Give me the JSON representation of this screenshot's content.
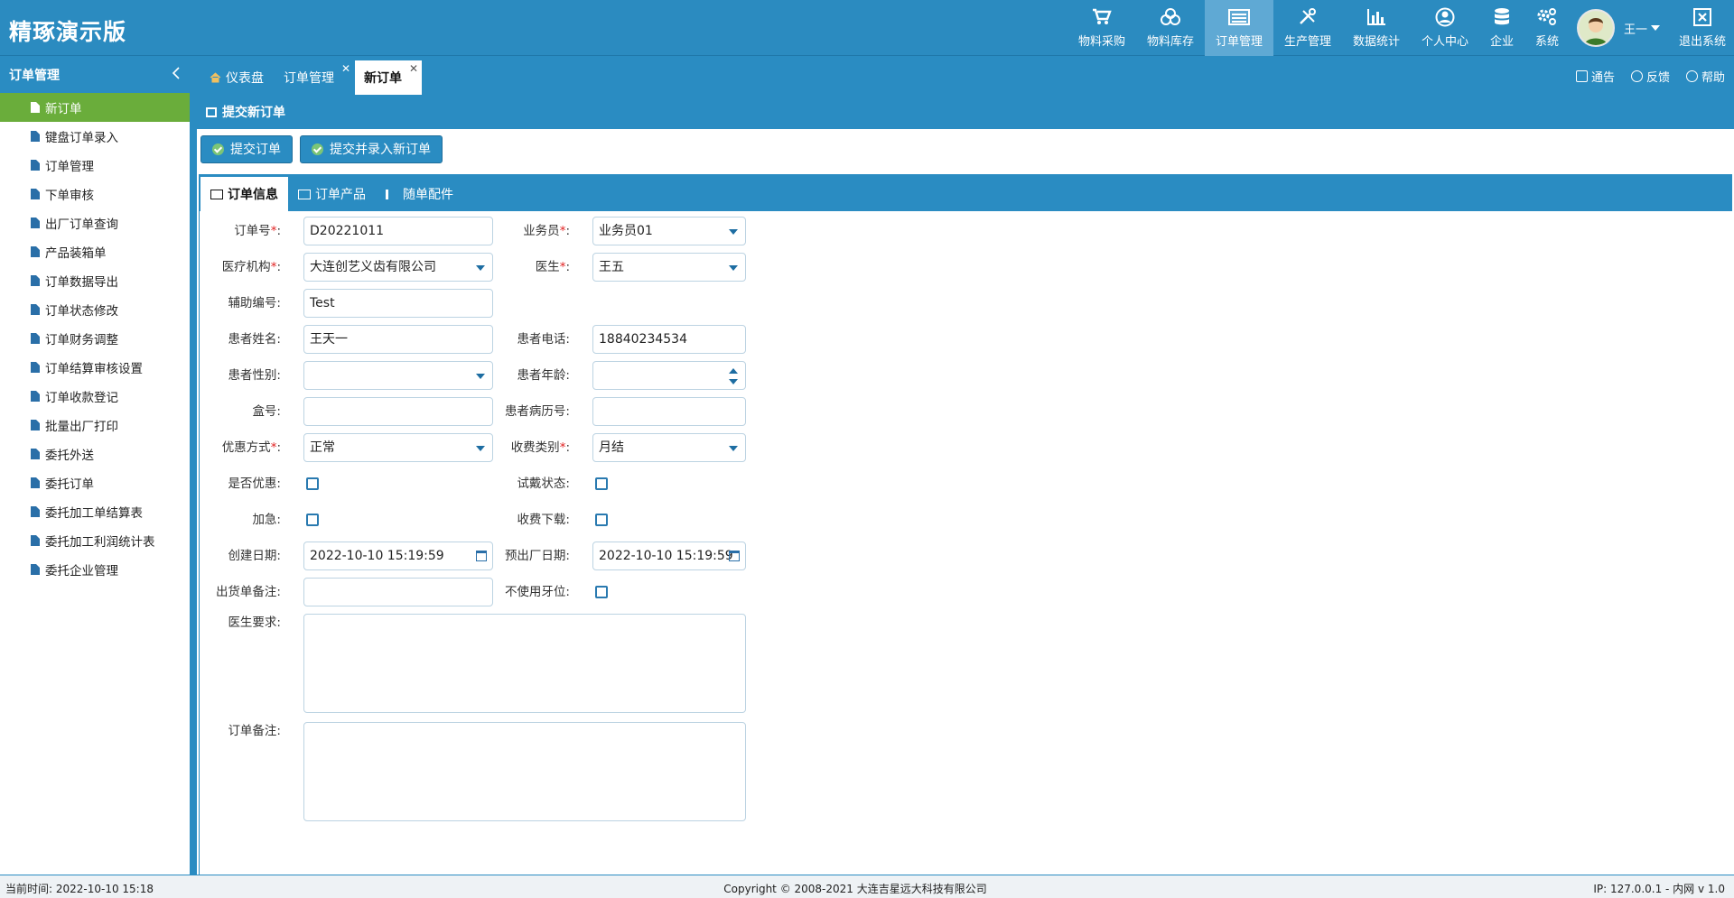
{
  "app": {
    "title": "精琢演示版"
  },
  "topnav": [
    {
      "label": "物料采购",
      "icon": "cart-icon"
    },
    {
      "label": "物料库存",
      "icon": "boxes-icon"
    },
    {
      "label": "订单管理",
      "icon": "order-list-icon",
      "active": true
    },
    {
      "label": "生产管理",
      "icon": "tools-icon"
    },
    {
      "label": "数据统计",
      "icon": "bar-chart-icon"
    },
    {
      "label": "个人中心",
      "icon": "user-circle-icon"
    },
    {
      "label": "企业",
      "icon": "database-icon"
    },
    {
      "label": "系统",
      "icon": "gears-icon"
    }
  ],
  "user": {
    "name": "王一"
  },
  "logout": {
    "label": "退出系统"
  },
  "sidebar": {
    "title": "订单管理",
    "items": [
      {
        "label": "新订单",
        "active": true
      },
      {
        "label": "键盘订单录入"
      },
      {
        "label": "订单管理"
      },
      {
        "label": "下单审核"
      },
      {
        "label": "出厂订单查询"
      },
      {
        "label": "产品装箱单"
      },
      {
        "label": "订单数据导出"
      },
      {
        "label": "订单状态修改"
      },
      {
        "label": "订单财务调整"
      },
      {
        "label": " 订单结算审核设置"
      },
      {
        "label": "订单收款登记"
      },
      {
        "label": "批量出厂打印"
      },
      {
        "label": "委托外送"
      },
      {
        "label": "委托订单"
      },
      {
        "label": "委托加工单结算表"
      },
      {
        "label": "委托加工利润统计表"
      },
      {
        "label": "委托企业管理"
      }
    ]
  },
  "tabs": [
    {
      "label": "仪表盘"
    },
    {
      "label": "订单管理",
      "closable": true
    },
    {
      "label": "新订单",
      "closable": true,
      "active": true
    }
  ],
  "tab_actions": {
    "notice": "通告",
    "feedback": "反馈",
    "help": "帮助"
  },
  "panel": {
    "title": "提交新订单"
  },
  "toolbar": {
    "submit": "提交订单",
    "submit_new": "提交并录入新订单"
  },
  "form_tabs": [
    {
      "label": "订单信息",
      "active": true
    },
    {
      "label": "订单产品"
    },
    {
      "label": "随单配件"
    }
  ],
  "form": {
    "order_no": {
      "label": "订单号",
      "value": "D20221011"
    },
    "salesman": {
      "label": "业务员",
      "value": "业务员01"
    },
    "institution": {
      "label": "医疗机构",
      "value": "大连创艺义齿有限公司"
    },
    "doctor": {
      "label": "医生",
      "value": "王五"
    },
    "aux_no": {
      "label": "辅助编号:",
      "value": "Test"
    },
    "patient_name": {
      "label": "患者姓名:",
      "value": "王天一"
    },
    "patient_phone": {
      "label": "患者电话:",
      "value": "18840234534"
    },
    "patient_gender": {
      "label": "患者性别:",
      "value": ""
    },
    "patient_age": {
      "label": "患者年龄:",
      "value": ""
    },
    "box_no": {
      "label": "盒号:",
      "value": ""
    },
    "record_no": {
      "label": "患者病历号:",
      "value": ""
    },
    "discount_method": {
      "label": "优惠方式",
      "value": "正常"
    },
    "charge_type": {
      "label": "收费类别",
      "value": "月结"
    },
    "is_discount": {
      "label": "是否优惠:",
      "checked": false
    },
    "try_status": {
      "label": "试戴状态:",
      "checked": false
    },
    "urgent": {
      "label": "加急:",
      "checked": false
    },
    "charge_download": {
      "label": "收费下载:",
      "checked": false
    },
    "created": {
      "label": "创建日期:",
      "value": "2022-10-10 15:19:59"
    },
    "expected": {
      "label": "预出厂日期:",
      "value": "2022-10-10 15:19:59"
    },
    "ship_note": {
      "label": "出货单备注:",
      "value": ""
    },
    "no_tooth_pos": {
      "label": "不使用牙位:",
      "checked": false
    },
    "doctor_req": {
      "label": "医生要求:",
      "value": ""
    },
    "order_note": {
      "label": "订单备注:",
      "value": ""
    }
  },
  "statusbar": {
    "time": "当前时间:  2022-10-10 15:18",
    "copyright": "Copyright © 2008-2021 大连吉星远大科技有限公司",
    "ip": "IP: 127.0.0.1 - 内网    v 1.0"
  }
}
